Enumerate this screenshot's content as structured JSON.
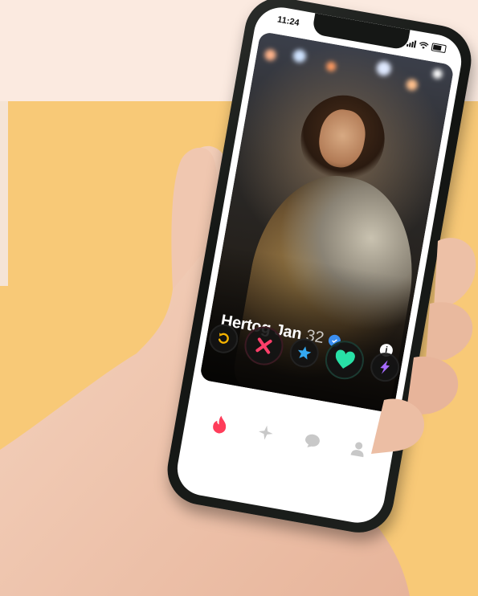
{
  "status_bar": {
    "time": "11:24"
  },
  "profile": {
    "name": "Hertog Jan",
    "age": "32",
    "verified_icon": "verified-check-icon",
    "info_icon": "info-icon"
  },
  "actions": [
    {
      "name": "rewind",
      "icon": "rewind-icon",
      "color": "#f5b300"
    },
    {
      "name": "nope",
      "icon": "x-icon",
      "color": "#ff3f6a"
    },
    {
      "name": "super-like",
      "icon": "star-icon",
      "color": "#34a9f1"
    },
    {
      "name": "like",
      "icon": "heart-icon",
      "color": "#28e0a6"
    },
    {
      "name": "boost",
      "icon": "bolt-icon",
      "color": "#a66bff"
    }
  ],
  "tabs": [
    {
      "name": "discover",
      "icon": "flame-icon",
      "active": true,
      "color": "#ff3d5a"
    },
    {
      "name": "explore",
      "icon": "sparkle-icon",
      "active": false,
      "color": "#c8c8c8"
    },
    {
      "name": "likes",
      "icon": "chat-icon",
      "active": false,
      "color": "#c8c8c8"
    },
    {
      "name": "profile",
      "icon": "user-icon",
      "active": false,
      "color": "#c8c8c8"
    }
  ],
  "colors": {
    "background": "#f8c977",
    "background_top": "#fbeae0"
  }
}
